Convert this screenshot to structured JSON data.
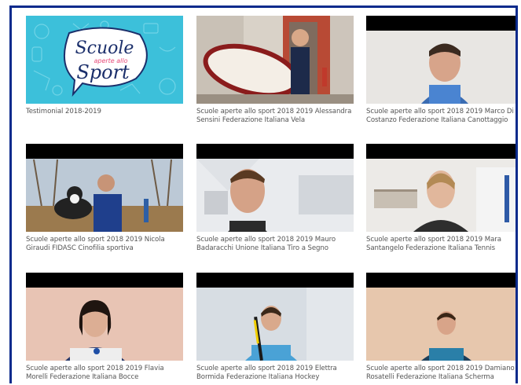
{
  "colors": {
    "frame": "#0a2a8c",
    "caption": "#555555"
  },
  "videos": [
    {
      "caption": "Testimonial 2018-2019",
      "logo_line1": "Scuole",
      "logo_line2": "aperte allo",
      "logo_line3": "Sport"
    },
    {
      "caption": "Scuole aperte allo sport 2018 2019 Alessandra Sensini Federazione Italiana Vela"
    },
    {
      "caption": "Scuole aperte allo sport 2018 2019 Marco Di Costanzo Federazione Italiana Canottaggio"
    },
    {
      "caption": "Scuole aperte allo sport 2018 2019 Nicola Giraudi FIDASC Cinofilia sportiva"
    },
    {
      "caption": "Scuole aperte allo sport 2018 2019 Mauro Badaracchi Unione Italiana Tiro a Segno"
    },
    {
      "caption": "Scuole aperte allo sport 2018 2019 Mara Santangelo Federazione Italiana Tennis"
    },
    {
      "caption": "Scuole aperte allo sport 2018 2019 Flavia Morelli Federazione Italiana Bocce"
    },
    {
      "caption": "Scuole aperte allo sport 2018 2019 Elettra Bormida Federazione Italiana Hockey"
    },
    {
      "caption": "Scuole aperte allo sport 2018 2019 Damiano Rosatelli Federazione Italiana Scherma"
    }
  ]
}
